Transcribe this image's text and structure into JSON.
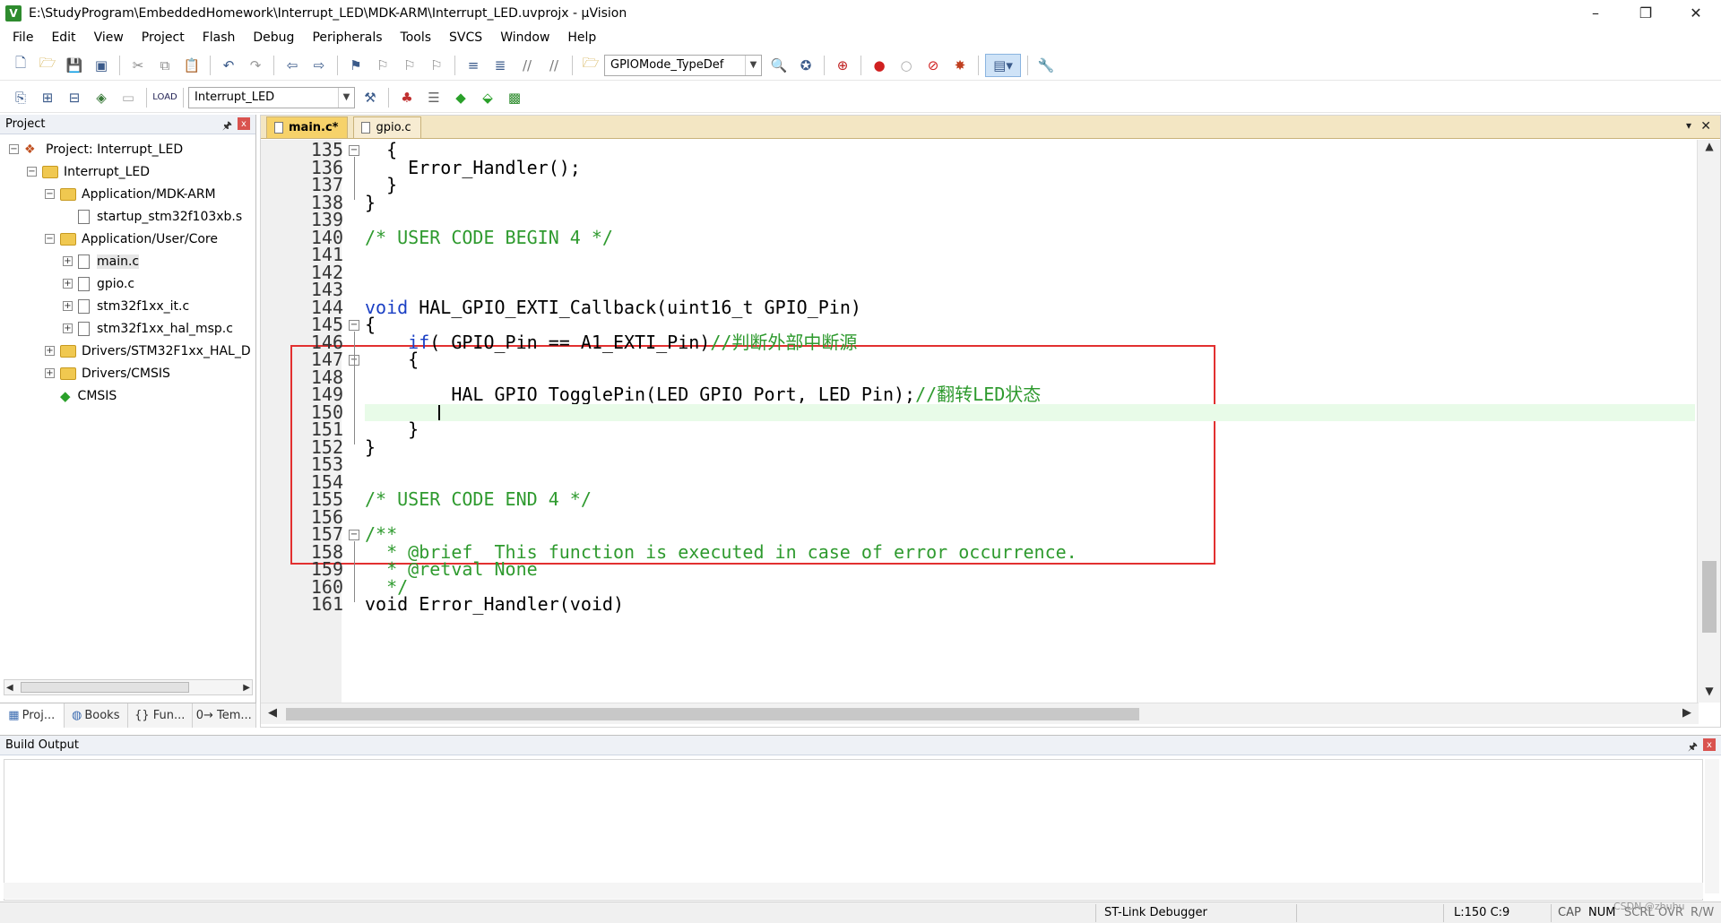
{
  "window": {
    "title": "E:\\StudyProgram\\EmbeddedHomework\\Interrupt_LED\\MDK-ARM\\Interrupt_LED.uvprojx - µVision",
    "icon_text": "V",
    "minimize": "–",
    "restore": "❐",
    "close": "✕"
  },
  "menu": [
    "File",
    "Edit",
    "View",
    "Project",
    "Flash",
    "Debug",
    "Peripherals",
    "Tools",
    "SVCS",
    "Window",
    "Help"
  ],
  "toolbar1": {
    "find_combo_value": "GPIOMode_TypeDef"
  },
  "toolbar2": {
    "target_combo_value": "Interrupt_LED"
  },
  "project_panel": {
    "title": "Project",
    "pin": "🖈",
    "close": "x",
    "tree": [
      {
        "label": "Project: Interrupt_LED",
        "level": 0,
        "expander": "−",
        "icon": "project"
      },
      {
        "label": "Interrupt_LED",
        "level": 1,
        "expander": "−",
        "icon": "folder"
      },
      {
        "label": "Application/MDK-ARM",
        "level": 2,
        "expander": "−",
        "icon": "folder"
      },
      {
        "label": "startup_stm32f103xb.s",
        "level": 3,
        "expander": "",
        "icon": "file"
      },
      {
        "label": "Application/User/Core",
        "level": 2,
        "expander": "−",
        "icon": "folder"
      },
      {
        "label": "main.c",
        "level": 3,
        "expander": "+",
        "icon": "file",
        "selected": true
      },
      {
        "label": "gpio.c",
        "level": 3,
        "expander": "+",
        "icon": "file"
      },
      {
        "label": "stm32f1xx_it.c",
        "level": 3,
        "expander": "+",
        "icon": "file"
      },
      {
        "label": "stm32f1xx_hal_msp.c",
        "level": 3,
        "expander": "+",
        "icon": "file"
      },
      {
        "label": "Drivers/STM32F1xx_HAL_D",
        "level": 2,
        "expander": "+",
        "icon": "folder"
      },
      {
        "label": "Drivers/CMSIS",
        "level": 2,
        "expander": "+",
        "icon": "folder"
      },
      {
        "label": "CMSIS",
        "level": 2,
        "expander": "",
        "icon": "gem"
      }
    ],
    "tabs": [
      "Proj...",
      "Books",
      "{} Fun...",
      "0→ Tem..."
    ]
  },
  "editor": {
    "tabs": [
      {
        "label": "main.c*",
        "active": true
      },
      {
        "label": "gpio.c",
        "active": false
      }
    ],
    "tab_menu": "▾",
    "tab_close": "✕",
    "current_line": 150,
    "lines": [
      {
        "n": "135",
        "fold": "−",
        "segs": [
          {
            "t": "  {",
            "c": ""
          }
        ]
      },
      {
        "n": "136",
        "fold": "",
        "segs": [
          {
            "t": "    Error_Handler();",
            "c": ""
          }
        ]
      },
      {
        "n": "137",
        "fold": "",
        "segs": [
          {
            "t": "  }",
            "c": ""
          }
        ]
      },
      {
        "n": "138",
        "fold": "",
        "segs": [
          {
            "t": "}",
            "c": ""
          }
        ]
      },
      {
        "n": "139",
        "fold": "",
        "segs": [
          {
            "t": "",
            "c": ""
          }
        ]
      },
      {
        "n": "140",
        "fold": "",
        "segs": [
          {
            "t": "/* USER CODE BEGIN 4 */",
            "c": "cm"
          }
        ]
      },
      {
        "n": "141",
        "fold": "",
        "segs": [
          {
            "t": "",
            "c": ""
          }
        ]
      },
      {
        "n": "142",
        "fold": "",
        "segs": [
          {
            "t": "",
            "c": ""
          }
        ]
      },
      {
        "n": "143",
        "fold": "",
        "segs": [
          {
            "t": "",
            "c": ""
          }
        ]
      },
      {
        "n": "144",
        "fold": "",
        "segs": [
          {
            "t": "void",
            "c": "kw"
          },
          {
            "t": " HAL_GPIO_EXTI_Callback(uint16_t GPIO_Pin)",
            "c": ""
          }
        ]
      },
      {
        "n": "145",
        "fold": "−",
        "segs": [
          {
            "t": "{",
            "c": ""
          }
        ]
      },
      {
        "n": "146",
        "fold": "",
        "segs": [
          {
            "t": "    ",
            "c": ""
          },
          {
            "t": "if",
            "c": "kw"
          },
          {
            "t": "( GPIO_Pin == A1_EXTI_Pin)",
            "c": ""
          },
          {
            "t": "//判断外部中断源",
            "c": "cm"
          }
        ]
      },
      {
        "n": "147",
        "fold": "−",
        "segs": [
          {
            "t": "    {",
            "c": ""
          }
        ]
      },
      {
        "n": "148",
        "fold": "",
        "segs": [
          {
            "t": "",
            "c": ""
          }
        ]
      },
      {
        "n": "149",
        "fold": "",
        "segs": [
          {
            "t": "        HAL_GPIO_TogglePin(LED_GPIO_Port, LED_Pin);",
            "c": ""
          },
          {
            "t": "//翻转LED状态",
            "c": "cm"
          }
        ]
      },
      {
        "n": "150",
        "fold": "",
        "segs": [
          {
            "t": "",
            "c": ""
          }
        ]
      },
      {
        "n": "151",
        "fold": "",
        "segs": [
          {
            "t": "    }",
            "c": ""
          }
        ]
      },
      {
        "n": "152",
        "fold": "",
        "segs": [
          {
            "t": "}",
            "c": ""
          }
        ]
      },
      {
        "n": "153",
        "fold": "",
        "segs": [
          {
            "t": "",
            "c": ""
          }
        ]
      },
      {
        "n": "154",
        "fold": "",
        "segs": [
          {
            "t": "",
            "c": ""
          }
        ]
      },
      {
        "n": "155",
        "fold": "",
        "segs": [
          {
            "t": "/* USER CODE END 4 */",
            "c": "cm"
          }
        ]
      },
      {
        "n": "156",
        "fold": "",
        "segs": [
          {
            "t": "",
            "c": ""
          }
        ]
      },
      {
        "n": "157",
        "fold": "−",
        "segs": [
          {
            "t": "/**",
            "c": "cm"
          }
        ]
      },
      {
        "n": "158",
        "fold": "",
        "segs": [
          {
            "t": "  * @brief  This function is executed in case of error occurrence.",
            "c": "cm"
          }
        ]
      },
      {
        "n": "159",
        "fold": "",
        "segs": [
          {
            "t": "  * @retval None",
            "c": "cm"
          }
        ]
      },
      {
        "n": "160",
        "fold": "",
        "segs": [
          {
            "t": "  */",
            "c": "cm"
          }
        ]
      },
      {
        "n": "161",
        "fold": "",
        "segs": [
          {
            "t": "void Error_Handler(void)",
            "c": ""
          }
        ]
      }
    ]
  },
  "build_output": {
    "title": "Build Output",
    "pin": "🖈",
    "close": "x"
  },
  "status": {
    "debugger": "ST-Link Debugger",
    "position": "L:150 C:9",
    "caps": "CAP",
    "num": "NUM",
    "scrl": "SCRL",
    "ovr": "OVR",
    "rw": "R/W",
    "watermark": "CSDN @zhuhu"
  },
  "colors": {
    "keyword": "#1a3fc4",
    "comment": "#2e9a2e",
    "highlight_box": "#e23030",
    "current_line": "#e8fbe8",
    "active_tab": "#f6d26a"
  }
}
